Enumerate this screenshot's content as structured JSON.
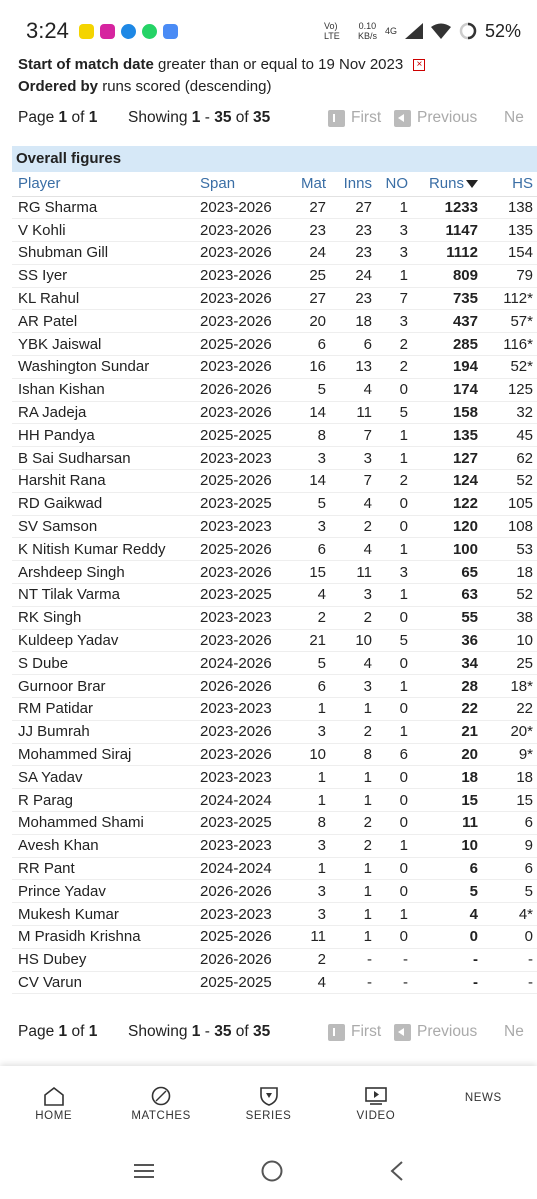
{
  "status_bar": {
    "time": "3:24",
    "network_speed": "0.10",
    "network_speed_unit": "KB/s",
    "network_type": "4G",
    "volte": "Vo) LTE",
    "battery": "52%"
  },
  "criteria": {
    "line1_label": "Start of match date",
    "line1_value": "greater than or equal to 19 Nov 2023",
    "line2_label": "Ordered by",
    "line2_value": "runs scored (descending)"
  },
  "pager": {
    "page_prefix": "Page",
    "page_current": "1",
    "page_of": "of",
    "page_total": "1",
    "showing_prefix": "Showing",
    "range_start": "1",
    "range_sep": "-",
    "range_end": "35",
    "range_of": "of",
    "range_total": "35",
    "first_label": "First",
    "previous_label": "Previous",
    "next_label_partial": "Ne"
  },
  "table": {
    "caption": "Overall figures",
    "headers": {
      "player": "Player",
      "span": "Span",
      "mat": "Mat",
      "inns": "Inns",
      "no": "NO",
      "runs": "Runs",
      "hs": "HS"
    },
    "rows": [
      {
        "player": "RG Sharma",
        "span": "2023-2026",
        "mat": "27",
        "inns": "27",
        "no": "1",
        "runs": "1233",
        "hs": "138"
      },
      {
        "player": "V Kohli",
        "span": "2023-2026",
        "mat": "23",
        "inns": "23",
        "no": "3",
        "runs": "1147",
        "hs": "135"
      },
      {
        "player": "Shubman Gill",
        "span": "2023-2026",
        "mat": "24",
        "inns": "23",
        "no": "3",
        "runs": "1112",
        "hs": "154"
      },
      {
        "player": "SS Iyer",
        "span": "2023-2026",
        "mat": "25",
        "inns": "24",
        "no": "1",
        "runs": "809",
        "hs": "79"
      },
      {
        "player": "KL Rahul",
        "span": "2023-2026",
        "mat": "27",
        "inns": "23",
        "no": "7",
        "runs": "735",
        "hs": "112*"
      },
      {
        "player": "AR Patel",
        "span": "2023-2026",
        "mat": "20",
        "inns": "18",
        "no": "3",
        "runs": "437",
        "hs": "57*"
      },
      {
        "player": "YBK Jaiswal",
        "span": "2025-2026",
        "mat": "6",
        "inns": "6",
        "no": "2",
        "runs": "285",
        "hs": "116*"
      },
      {
        "player": "Washington Sundar",
        "span": "2023-2026",
        "mat": "16",
        "inns": "13",
        "no": "2",
        "runs": "194",
        "hs": "52*"
      },
      {
        "player": "Ishan Kishan",
        "span": "2026-2026",
        "mat": "5",
        "inns": "4",
        "no": "0",
        "runs": "174",
        "hs": "125"
      },
      {
        "player": "RA Jadeja",
        "span": "2023-2026",
        "mat": "14",
        "inns": "11",
        "no": "5",
        "runs": "158",
        "hs": "32"
      },
      {
        "player": "HH Pandya",
        "span": "2025-2025",
        "mat": "8",
        "inns": "7",
        "no": "1",
        "runs": "135",
        "hs": "45"
      },
      {
        "player": "B Sai Sudharsan",
        "span": "2023-2023",
        "mat": "3",
        "inns": "3",
        "no": "1",
        "runs": "127",
        "hs": "62"
      },
      {
        "player": "Harshit Rana",
        "span": "2025-2026",
        "mat": "14",
        "inns": "7",
        "no": "2",
        "runs": "124",
        "hs": "52"
      },
      {
        "player": "RD Gaikwad",
        "span": "2023-2025",
        "mat": "5",
        "inns": "4",
        "no": "0",
        "runs": "122",
        "hs": "105"
      },
      {
        "player": "SV Samson",
        "span": "2023-2023",
        "mat": "3",
        "inns": "2",
        "no": "0",
        "runs": "120",
        "hs": "108"
      },
      {
        "player": "K Nitish Kumar Reddy",
        "span": "2025-2026",
        "mat": "6",
        "inns": "4",
        "no": "1",
        "runs": "100",
        "hs": "53"
      },
      {
        "player": "Arshdeep Singh",
        "span": "2023-2026",
        "mat": "15",
        "inns": "11",
        "no": "3",
        "runs": "65",
        "hs": "18"
      },
      {
        "player": "NT Tilak Varma",
        "span": "2023-2025",
        "mat": "4",
        "inns": "3",
        "no": "1",
        "runs": "63",
        "hs": "52"
      },
      {
        "player": "RK Singh",
        "span": "2023-2023",
        "mat": "2",
        "inns": "2",
        "no": "0",
        "runs": "55",
        "hs": "38"
      },
      {
        "player": "Kuldeep Yadav",
        "span": "2023-2026",
        "mat": "21",
        "inns": "10",
        "no": "5",
        "runs": "36",
        "hs": "10"
      },
      {
        "player": "S Dube",
        "span": "2024-2026",
        "mat": "5",
        "inns": "4",
        "no": "0",
        "runs": "34",
        "hs": "25"
      },
      {
        "player": "Gurnoor Brar",
        "span": "2026-2026",
        "mat": "6",
        "inns": "3",
        "no": "1",
        "runs": "28",
        "hs": "18*"
      },
      {
        "player": "RM Patidar",
        "span": "2023-2023",
        "mat": "1",
        "inns": "1",
        "no": "0",
        "runs": "22",
        "hs": "22"
      },
      {
        "player": "JJ Bumrah",
        "span": "2023-2026",
        "mat": "3",
        "inns": "2",
        "no": "1",
        "runs": "21",
        "hs": "20*"
      },
      {
        "player": "Mohammed Siraj",
        "span": "2023-2026",
        "mat": "10",
        "inns": "8",
        "no": "6",
        "runs": "20",
        "hs": "9*"
      },
      {
        "player": "SA Yadav",
        "span": "2023-2023",
        "mat": "1",
        "inns": "1",
        "no": "0",
        "runs": "18",
        "hs": "18"
      },
      {
        "player": "R Parag",
        "span": "2024-2024",
        "mat": "1",
        "inns": "1",
        "no": "0",
        "runs": "15",
        "hs": "15"
      },
      {
        "player": "Mohammed Shami",
        "span": "2023-2025",
        "mat": "8",
        "inns": "2",
        "no": "0",
        "runs": "11",
        "hs": "6"
      },
      {
        "player": "Avesh Khan",
        "span": "2023-2023",
        "mat": "3",
        "inns": "2",
        "no": "1",
        "runs": "10",
        "hs": "9"
      },
      {
        "player": "RR Pant",
        "span": "2024-2024",
        "mat": "1",
        "inns": "1",
        "no": "0",
        "runs": "6",
        "hs": "6"
      },
      {
        "player": "Prince Yadav",
        "span": "2026-2026",
        "mat": "3",
        "inns": "1",
        "no": "0",
        "runs": "5",
        "hs": "5"
      },
      {
        "player": "Mukesh Kumar",
        "span": "2023-2023",
        "mat": "3",
        "inns": "1",
        "no": "1",
        "runs": "4",
        "hs": "4*"
      },
      {
        "player": "M Prasidh Krishna",
        "span": "2025-2026",
        "mat": "11",
        "inns": "1",
        "no": "0",
        "runs": "0",
        "hs": "0"
      },
      {
        "player": "HS Dubey",
        "span": "2026-2026",
        "mat": "2",
        "inns": "-",
        "no": "-",
        "runs": "-",
        "hs": "-"
      },
      {
        "player": "CV Varun",
        "span": "2025-2025",
        "mat": "4",
        "inns": "-",
        "no": "-",
        "runs": "-",
        "hs": "-"
      }
    ]
  },
  "bottom_nav": {
    "home": "HOME",
    "matches": "MATCHES",
    "series": "SERIES",
    "video": "VIDEO",
    "news": "NEWS"
  },
  "colors": {
    "caption_bg": "#d6e8f7",
    "header_text": "#3a6ea5",
    "disabled_nav": "#aaaaaa"
  }
}
